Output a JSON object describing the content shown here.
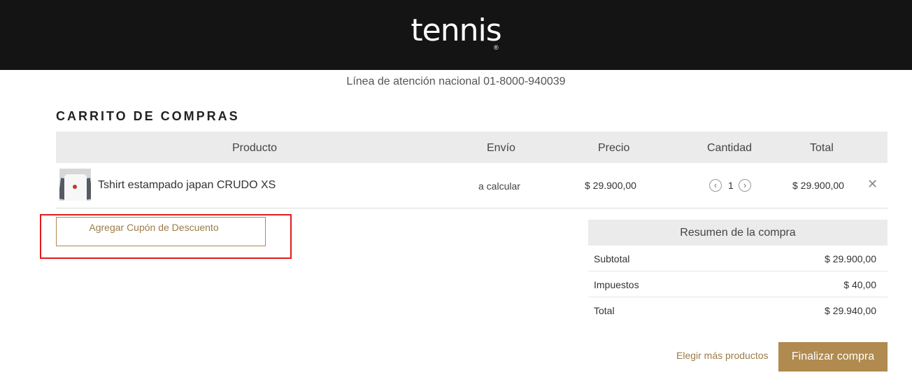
{
  "brand": {
    "logo": "tennis",
    "registered": "®"
  },
  "hotline": "Línea de atención nacional 01-8000-940039",
  "cart": {
    "title": "CARRITO DE COMPRAS",
    "columns": {
      "product": "Producto",
      "shipping": "Envío",
      "price": "Precio",
      "quantity": "Cantidad",
      "total": "Total"
    },
    "items": [
      {
        "name": "Tshirt estampado japan CRUDO XS",
        "shipping": "a calcular",
        "price": "$ 29.900,00",
        "quantity": "1",
        "total": "$ 29.900,00",
        "icons": {
          "thumbnail": "product-thumbnail",
          "decrease": "chevron-left-circle",
          "increase": "chevron-right-circle",
          "remove": "close-x"
        }
      }
    ]
  },
  "coupon": {
    "label": "Agregar Cupón de Descuento"
  },
  "summary": {
    "title": "Resumen de la compra",
    "rows": [
      {
        "label": "Subtotal",
        "value": "$ 29.900,00"
      },
      {
        "label": "Impuestos",
        "value": "$ 40,00"
      },
      {
        "label": "Total",
        "value": "$ 29.940,00"
      }
    ]
  },
  "actions": {
    "more_products": "Elegir más productos",
    "checkout": "Finalizar compra"
  },
  "colors": {
    "header": "#141414",
    "accent": "#b08a4f",
    "highlight": "#e11b1b",
    "table_header": "#ebebeb"
  }
}
